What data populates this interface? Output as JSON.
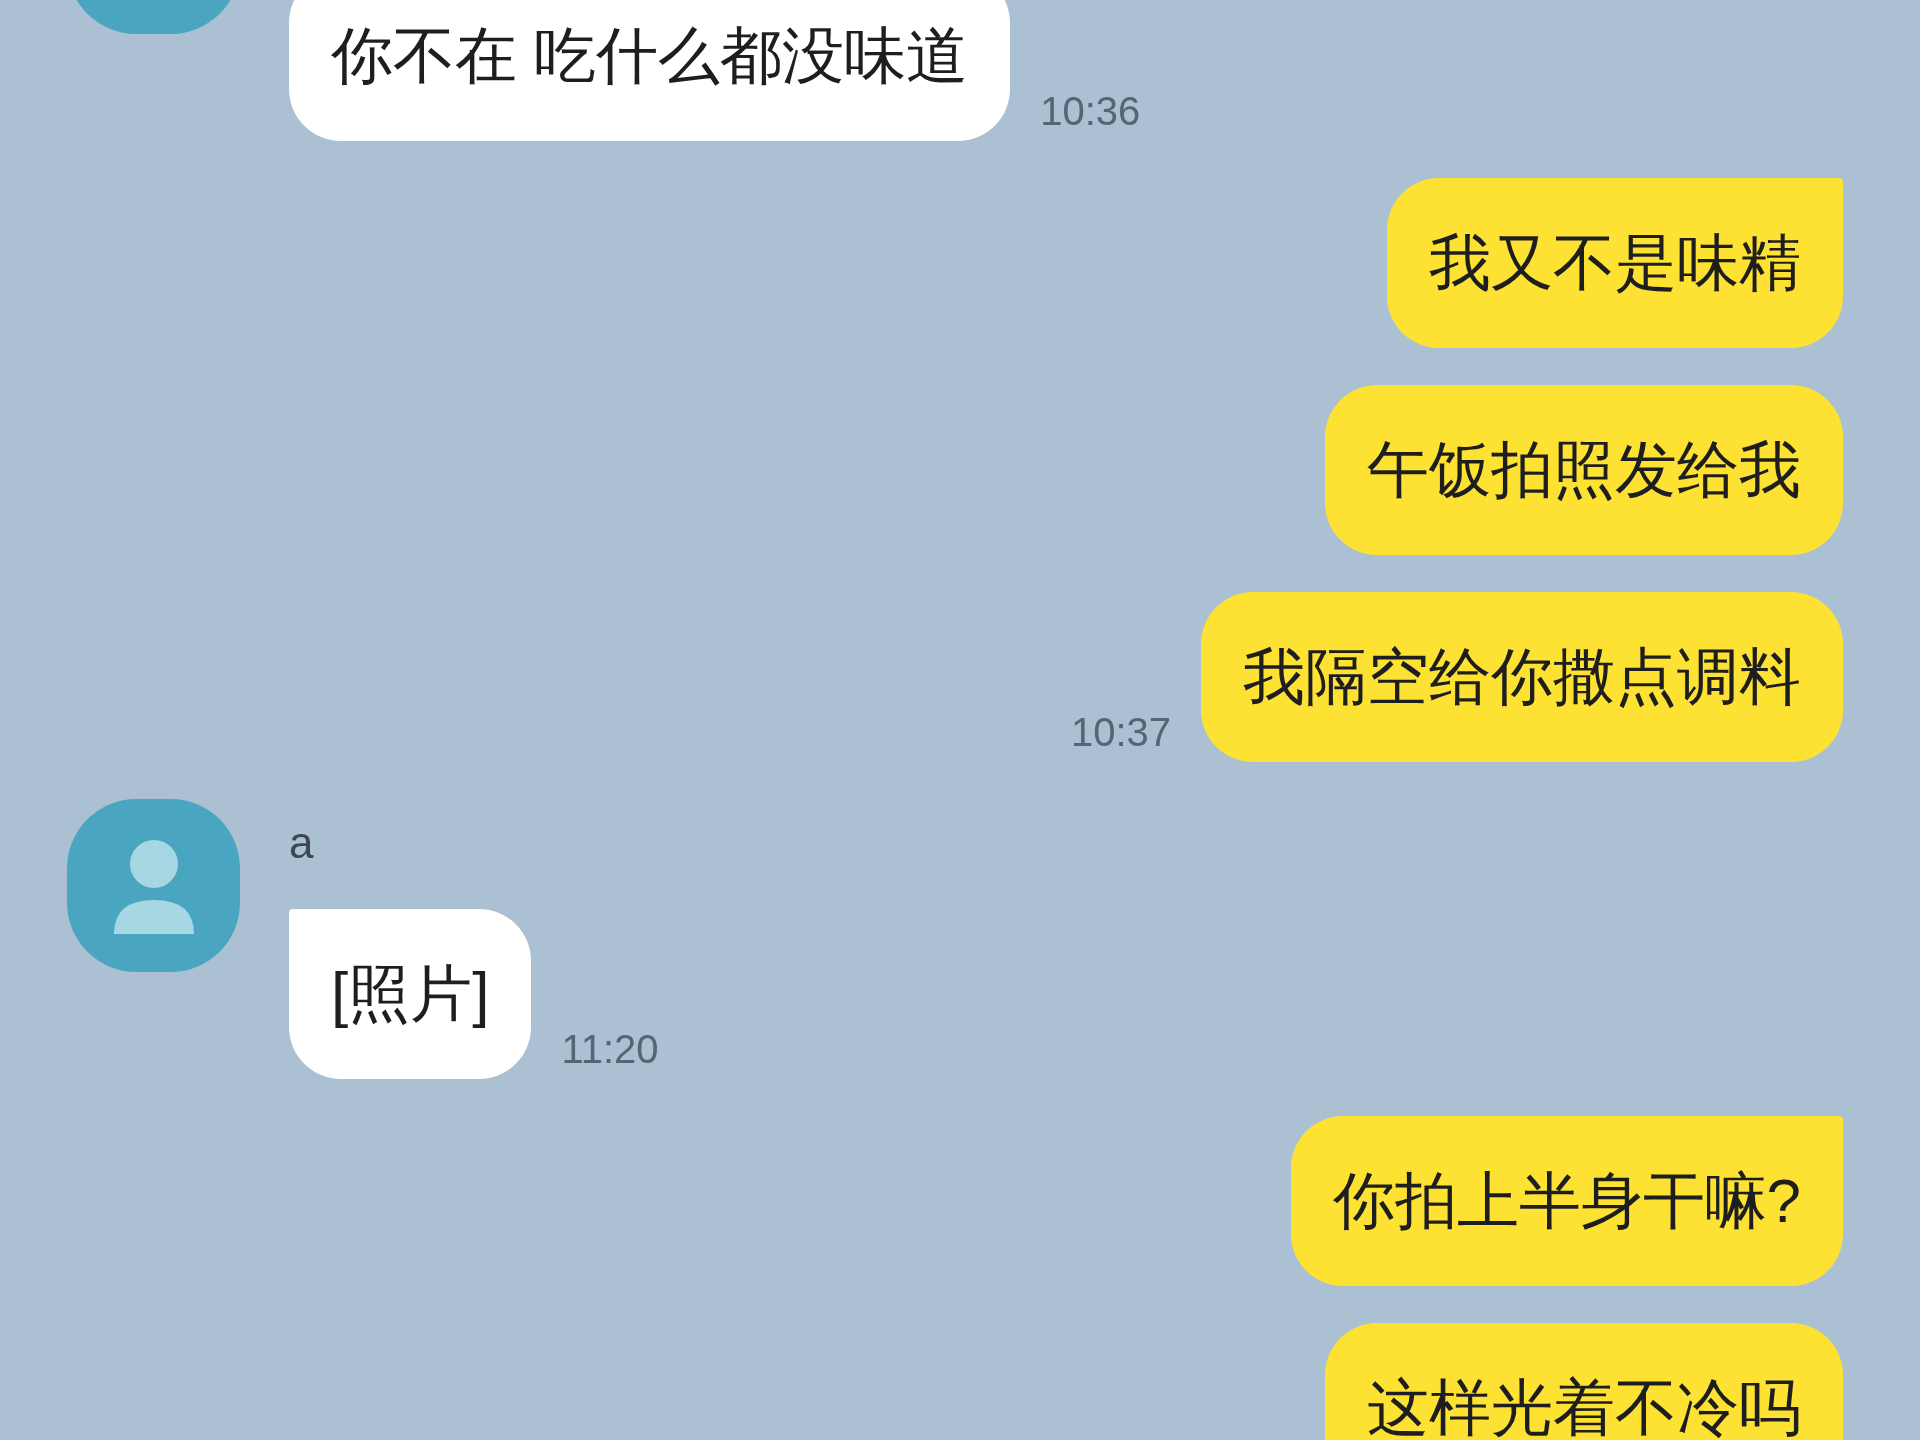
{
  "messages": [
    {
      "kind": "incoming",
      "text": "你不在 吃什么都没味道",
      "time": "10:36",
      "tail": false
    },
    {
      "kind": "outgoing",
      "text": "我又不是味精",
      "tail": true
    },
    {
      "kind": "outgoing",
      "text": "午饭拍照发给我",
      "tail": false
    },
    {
      "kind": "outgoing",
      "text": "我隔空给你撒点调料",
      "time": "10:37",
      "tail": false
    },
    {
      "kind": "incoming",
      "sender": "a",
      "text": "[照片]",
      "time": "11:20",
      "tail": true
    },
    {
      "kind": "outgoing",
      "text": "你拍上半身干嘛?",
      "tail": true
    },
    {
      "kind": "outgoing",
      "text": "这样光着不冷吗",
      "tail": false
    }
  ]
}
